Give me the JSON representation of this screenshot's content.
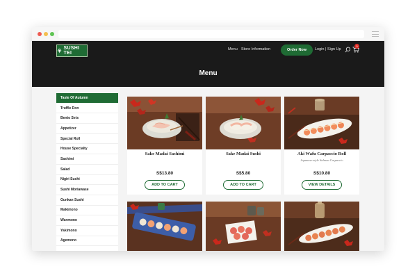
{
  "nav": {
    "logo_text": "SUSHI TEI",
    "links": [
      "Menu",
      "Store Information"
    ],
    "order_button": "Order Now",
    "login": "Login | Sign Up",
    "cart_count": "0"
  },
  "page_title": "Menu",
  "sidebar": {
    "items": [
      "Taste Of Autumn",
      "Truffle Don",
      "Bento Sets",
      "Appetizer",
      "Special Roll",
      "House Specialty",
      "Sashimi",
      "Salad",
      "Nigiri Sushi",
      "Sushi Moriawase",
      "Gunkan Sushi",
      "Makimono",
      "Wanmono",
      "Yakimono",
      "Agemono"
    ],
    "active_index": 0
  },
  "cards": [
    {
      "title": "Sake Madai Sashimi",
      "subtitle": "",
      "price": "S$13.80",
      "button": "ADD TO CART"
    },
    {
      "title": "Sake Madai Sushi",
      "subtitle": "",
      "price": "S$5.80",
      "button": "ADD TO CART"
    },
    {
      "title": "Aki Wafu Carpaccio Roll",
      "subtitle": "Japanese-style Salmon Carpaccio",
      "price": "S$10.80",
      "button": "VIEW DETAILS"
    }
  ],
  "colors": {
    "brand_green": "#1f6b34",
    "header_dark": "#1a1a1a",
    "badge_red": "#e2312a"
  }
}
